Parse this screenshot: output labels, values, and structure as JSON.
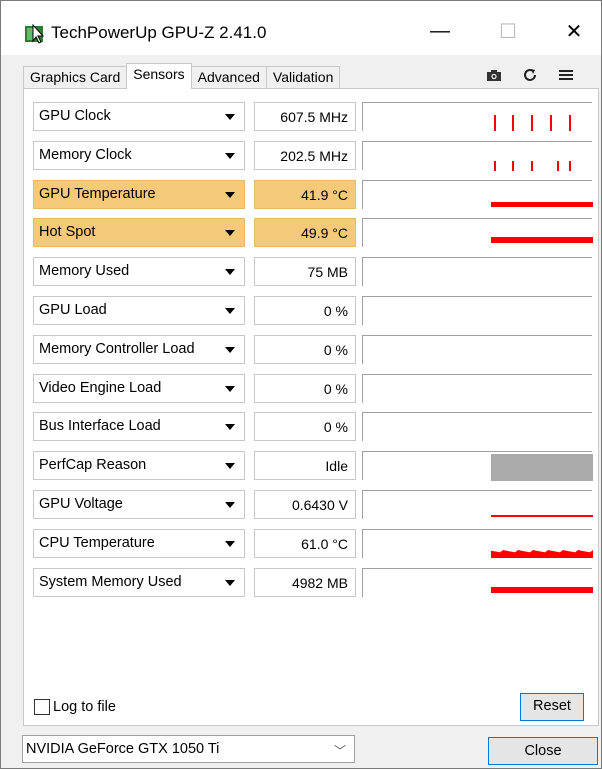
{
  "window": {
    "title": "TechPowerUp GPU-Z 2.41.0",
    "minimize_glyph": "—",
    "maximize_glyph": "☐",
    "close_glyph": "✕"
  },
  "tabs": [
    {
      "label": "Graphics Card",
      "active": false
    },
    {
      "label": "Sensors",
      "active": true
    },
    {
      "label": "Advanced",
      "active": false
    },
    {
      "label": "Validation",
      "active": false
    }
  ],
  "toolbar_icons": [
    "camera-icon",
    "refresh-icon",
    "menu-icon"
  ],
  "sensors": [
    {
      "label": "GPU Clock",
      "value": "607.5 MHz",
      "highlighted": false,
      "graph": "spikes"
    },
    {
      "label": "Memory Clock",
      "value": "202.5 MHz",
      "highlighted": false,
      "graph": "spikes-small"
    },
    {
      "label": "GPU Temperature",
      "value": "41.9 °C",
      "highlighted": true,
      "graph": "flat-line"
    },
    {
      "label": "Hot Spot",
      "value": "49.9 °C",
      "highlighted": true,
      "graph": "flat-line-thick"
    },
    {
      "label": "Memory Used",
      "value": "75 MB",
      "highlighted": false,
      "graph": "none"
    },
    {
      "label": "GPU Load",
      "value": "0 %",
      "highlighted": false,
      "graph": "none"
    },
    {
      "label": "Memory Controller Load",
      "value": "0 %",
      "highlighted": false,
      "graph": "none"
    },
    {
      "label": "Video Engine Load",
      "value": "0 %",
      "highlighted": false,
      "graph": "none"
    },
    {
      "label": "Bus Interface Load",
      "value": "0 %",
      "highlighted": false,
      "graph": "none"
    },
    {
      "label": "PerfCap Reason",
      "value": "Idle",
      "highlighted": false,
      "graph": "grey-block"
    },
    {
      "label": "GPU Voltage",
      "value": "0.6430 V",
      "highlighted": false,
      "graph": "thin-line"
    },
    {
      "label": "CPU Temperature",
      "value": "61.0 °C",
      "highlighted": false,
      "graph": "noisy-line"
    },
    {
      "label": "System Memory Used",
      "value": "4982 MB",
      "highlighted": false,
      "graph": "flat-line-thick"
    }
  ],
  "log_to_file": {
    "label": "Log to file",
    "checked": false
  },
  "reset_label": "Reset",
  "gpu_select": {
    "value": "NVIDIA GeForce GTX 1050 Ti"
  },
  "close_label": "Close",
  "colors": {
    "highlight": "#f4c979",
    "graph_line": "#ff0000",
    "perfcap_block": "#aaaaaa"
  }
}
